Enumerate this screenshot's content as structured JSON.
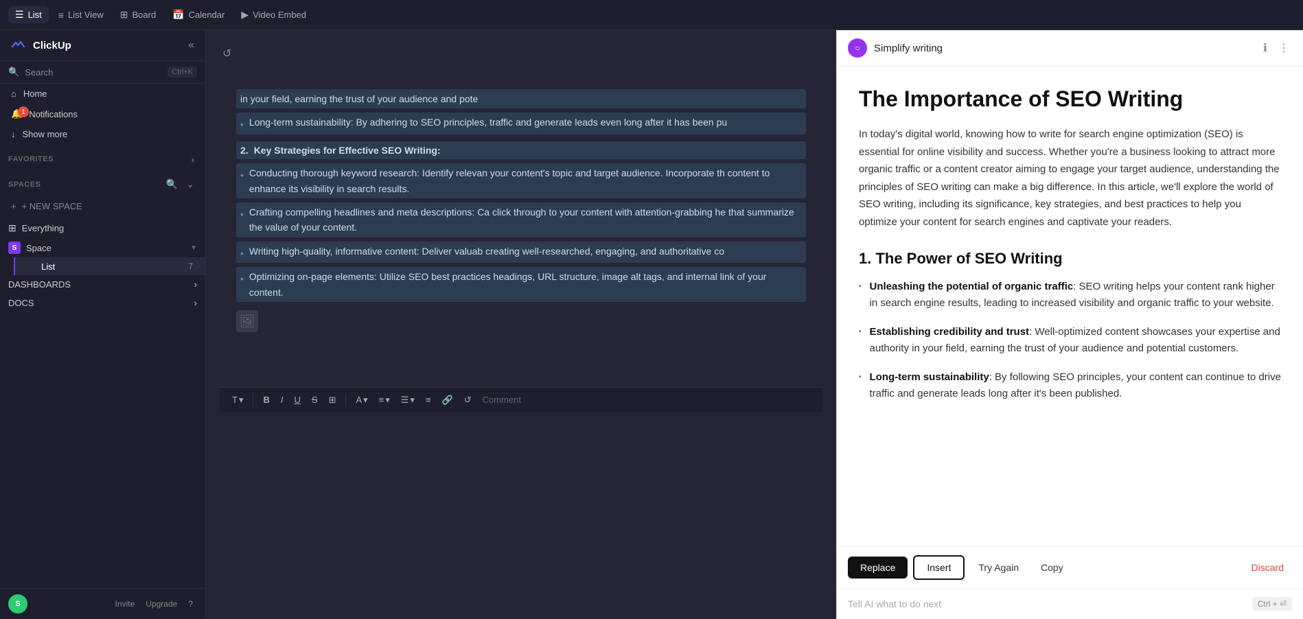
{
  "topnav": {
    "tabs": [
      {
        "id": "list",
        "icon": "☰",
        "label": "List",
        "active": true
      },
      {
        "id": "listview",
        "icon": "≡",
        "label": "List View",
        "active": false
      },
      {
        "id": "board",
        "icon": "⊞",
        "label": "Board",
        "active": false
      },
      {
        "id": "calendar",
        "icon": "📅",
        "label": "Calendar",
        "active": false
      },
      {
        "id": "videoembed",
        "icon": "▶",
        "label": "Video Embed",
        "active": false
      }
    ]
  },
  "sidebar": {
    "logo": "ClickUp",
    "search_placeholder": "Search",
    "search_shortcut": "Ctrl+K",
    "nav_items": [
      {
        "id": "home",
        "icon": "⌂",
        "label": "Home",
        "badge": null
      },
      {
        "id": "notifications",
        "icon": "🔔",
        "label": "Notifications",
        "badge": "1"
      },
      {
        "id": "showmore",
        "icon": "↓",
        "label": "Show more",
        "badge": null
      }
    ],
    "favorites_label": "FAVORITES",
    "spaces_label": "SPACES",
    "new_space_label": "+ NEW SPACE",
    "everything_label": "Everything",
    "space_name": "Space",
    "space_initial": "S",
    "list_label": "List",
    "list_count": "7",
    "dashboards_label": "DASHBOARDS",
    "docs_label": "DOCS",
    "footer": {
      "invite_label": "Invite",
      "upgrade_label": "Upgrade",
      "help_label": "?"
    }
  },
  "editor": {
    "refresh_icon": "↺",
    "content": {
      "intro_highlighted": "in your field, earning the trust of your audience and pote",
      "items": [
        {
          "type": "bullet",
          "highlighted": true,
          "text": "Long-term sustainability: By adhering to SEO principles, traffic and generate leads even long after it has been pu"
        },
        {
          "type": "numbered",
          "number": "2.",
          "highlighted": true,
          "text": "Key Strategies for Effective SEO Writing:"
        },
        {
          "type": "bullet",
          "highlighted": true,
          "text": "Conducting thorough keyword research: Identify relevan your content's topic and target audience. Incorporate th content to enhance its visibility in search results."
        },
        {
          "type": "bullet",
          "highlighted": true,
          "text": "Crafting compelling headlines and meta descriptions: Ca click through to your content with attention-grabbing he that summarize the value of your content."
        },
        {
          "type": "bullet",
          "highlighted": true,
          "text": "Writing high-quality, informative content: Deliver valuab creating well-researched, engaging, and authoritative co"
        },
        {
          "type": "bullet",
          "highlighted": true,
          "text": "Optimizing on-page elements: Utilize SEO best practices headings, URL structure, image alt tags, and internal link of your content."
        }
      ]
    },
    "toolbar": {
      "text_label": "T",
      "bold_label": "B",
      "italic_label": "I",
      "underline_label": "U",
      "strikethrough_label": "S",
      "table_label": "⊞",
      "color_label": "A",
      "align_label": "≡",
      "list_label": "☰",
      "list2_label": "≡",
      "link_label": "🔗",
      "undo_label": "↺",
      "comment_label": "Comment"
    }
  },
  "ai_panel": {
    "title": "Simplify writing",
    "main_title": "The Importance of SEO Writing",
    "intro": "In today's digital world, knowing how to write for search engine optimization (SEO) is essential for online visibility and success. Whether you're a business looking to attract more organic traffic or a content creator aiming to engage your target audience, understanding the principles of SEO writing can make a big difference. In this article, we'll explore the world of SEO writing, including its significance, key strategies, and best practices to help you optimize your content for search engines and captivate your readers.",
    "section1_title": "1. The Power of SEO Writing",
    "bullets": [
      {
        "bold": "Unleashing the potential of organic traffic",
        "text": ": SEO writing helps your content rank higher in search engine results, leading to increased visibility and organic traffic to your website."
      },
      {
        "bold": "Establishing credibility and trust",
        "text": ": Well-optimized content showcases your expertise and authority in your field, earning the trust of your audience and potential customers."
      },
      {
        "bold": "Long-term sustainability",
        "text": ": By following SEO principles, your content can continue to drive traffic and generate leads long after it's been published."
      }
    ],
    "actions": {
      "replace": "Replace",
      "insert": "Insert",
      "try_again": "Try Again",
      "copy": "Copy",
      "discard": "Discard"
    },
    "input_placeholder": "Tell AI what to do next",
    "input_shortcut": "Ctrl + ⏎"
  }
}
